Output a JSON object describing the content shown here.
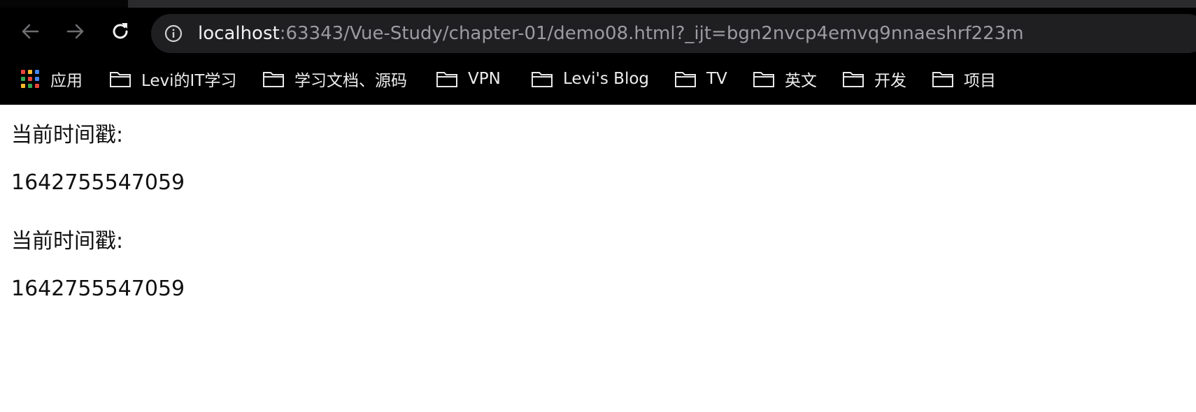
{
  "browser": {
    "url_host": "localhost",
    "url_rest": ":63343/Vue-Study/chapter-01/demo08.html?_ijt=bgn2nvcp4emvq9nnaeshrf223m",
    "bookmarks": [
      {
        "label": "应用",
        "icon": "apps-grid-icon"
      },
      {
        "label": "Levi的IT学习",
        "icon": "folder-icon"
      },
      {
        "label": "学习文档、源码",
        "icon": "folder-icon"
      },
      {
        "label": "VPN",
        "icon": "folder-icon"
      },
      {
        "label": "Levi's Blog",
        "icon": "folder-icon"
      },
      {
        "label": "TV",
        "icon": "folder-icon"
      },
      {
        "label": "英文",
        "icon": "folder-icon"
      },
      {
        "label": "开发",
        "icon": "folder-icon"
      },
      {
        "label": "项目",
        "icon": "folder-icon"
      }
    ]
  },
  "page": {
    "blocks": [
      {
        "label": "当前时间戳:",
        "value": "1642755547059"
      },
      {
        "label": "当前时间戳:",
        "value": "1642755547059"
      }
    ]
  },
  "colors": {
    "chrome_bg": "#000000",
    "omnibox_bg": "#1f1f22",
    "url_host": "#f1f1f1",
    "url_rest": "#9b9ba0",
    "page_bg": "#ffffff",
    "page_text": "#111111"
  }
}
